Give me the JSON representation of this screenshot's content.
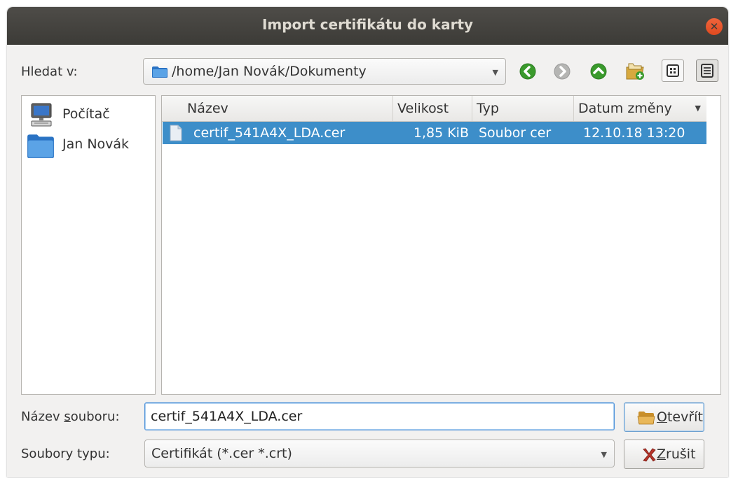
{
  "window": {
    "title": "Import certifikátu do karty"
  },
  "lookin": {
    "label": "Hledat v:",
    "path": "/home/Jan Novák/Dokumenty"
  },
  "sidebar": {
    "items": [
      {
        "label": "Počítač",
        "icon": "computer-icon"
      },
      {
        "label": "Jan Novák",
        "icon": "folder-icon"
      }
    ]
  },
  "filelist": {
    "columns": [
      "Název",
      "Velikost",
      "Typ",
      "Datum změny"
    ],
    "rows": [
      {
        "name": "certif_541A4X_LDA.cer",
        "size": "1,85 KiB",
        "type": "Soubor cer",
        "date": "12.10.18 13:20"
      }
    ]
  },
  "filename": {
    "label_pre": "Název ",
    "label_u": "s",
    "label_post": "ouboru:",
    "value": "certif_541A4X_LDA.cer"
  },
  "filetype": {
    "label": "Soubory typu:",
    "value": "Certifikát (*.cer *.crt)"
  },
  "buttons": {
    "open": {
      "u": "O",
      "rest": "tevřít"
    },
    "cancel": {
      "u": "Z",
      "rest": "rušit"
    }
  },
  "colors": {
    "selection": "#3d8ec9",
    "titlebar": "#3c3b37",
    "close": "#e95420",
    "nav_green": "#3a9a2c"
  }
}
